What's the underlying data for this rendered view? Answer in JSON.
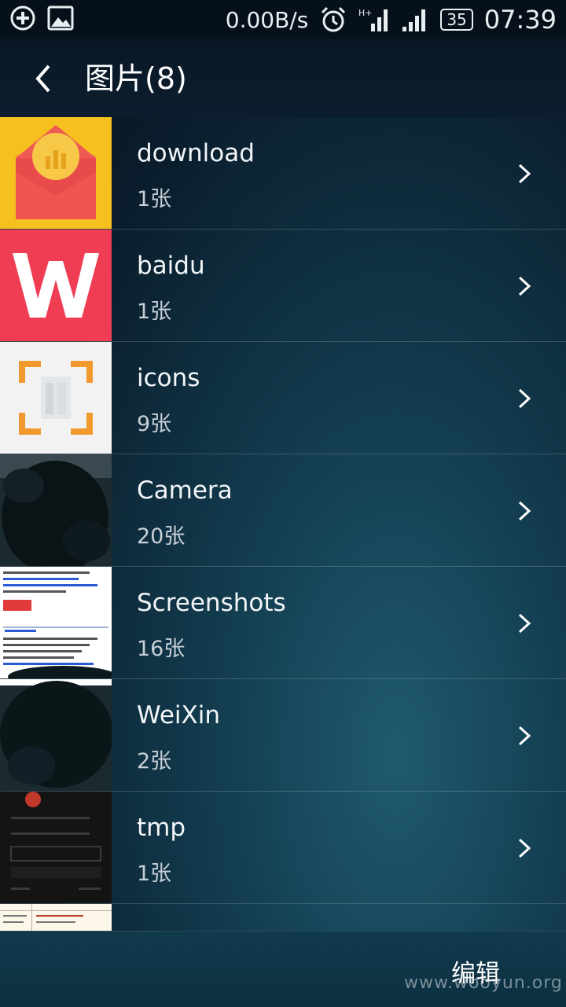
{
  "status_bar": {
    "net_speed": "0.00B/s",
    "battery": "35",
    "time": "07:39"
  },
  "app_bar": {
    "title": "图片(8)"
  },
  "albums": [
    {
      "name": "download",
      "count": "1张",
      "thumb": "red-envelope-app-icon"
    },
    {
      "name": "baidu",
      "count": "1张",
      "thumb": "wps-office-app-icon"
    },
    {
      "name": "icons",
      "count": "9张",
      "thumb": "scanner-app-icon"
    },
    {
      "name": "Camera",
      "count": "20张",
      "thumb": "dark-photo"
    },
    {
      "name": "Screenshots",
      "count": "16张",
      "thumb": "text-screenshot"
    },
    {
      "name": "WeiXin",
      "count": "2张",
      "thumb": "dark-photo"
    },
    {
      "name": "tmp",
      "count": "1张",
      "thumb": "dark-screenshot"
    }
  ],
  "bottom_bar": {
    "edit_label": "编辑"
  },
  "watermark": "www.wooyun.org",
  "colors": {
    "status_bar_bg": "#06101a",
    "app_bar_bg": "#0c1d2d",
    "bottom_bar_bg": "#0c2f40",
    "text_primary": "#f3f6f8",
    "text_secondary": "#c7d0d6"
  }
}
